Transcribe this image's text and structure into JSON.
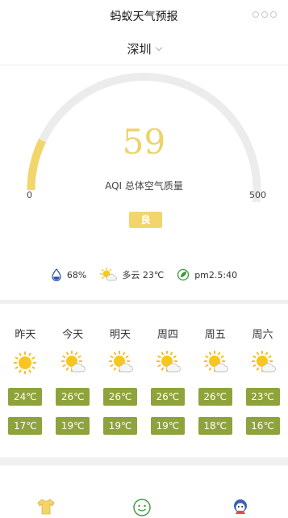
{
  "nav": {
    "title": "蚂蚁天气预报"
  },
  "city": {
    "name": "深圳"
  },
  "aqi": {
    "value": "59",
    "label": "AQI 总体空气质量",
    "min": "0",
    "max": "500",
    "level": "良",
    "level_fraction": 0.118,
    "color": "#ecd36a"
  },
  "conditions": {
    "humidity": "68%",
    "weather": "多云 23℃",
    "pm25": "pm2.5:40"
  },
  "forecast": [
    {
      "day": "昨天",
      "icon": "sunny-icon",
      "high": "24℃",
      "low": "17℃"
    },
    {
      "day": "今天",
      "icon": "partly-cloudy-icon",
      "high": "26℃",
      "low": "19℃"
    },
    {
      "day": "明天",
      "icon": "partly-cloudy-icon",
      "high": "26℃",
      "low": "19℃"
    },
    {
      "day": "周四",
      "icon": "partly-cloudy-icon",
      "high": "26℃",
      "low": "19℃"
    },
    {
      "day": "周五",
      "icon": "partly-cloudy-icon",
      "high": "26℃",
      "low": "18℃"
    },
    {
      "day": "周六",
      "icon": "partly-cloudy-icon",
      "high": "23℃",
      "low": "16℃"
    }
  ],
  "colors": {
    "temp_badge": "#8ea33c",
    "level_badge": "#f2d66b",
    "gauge_track": "#ececec"
  }
}
